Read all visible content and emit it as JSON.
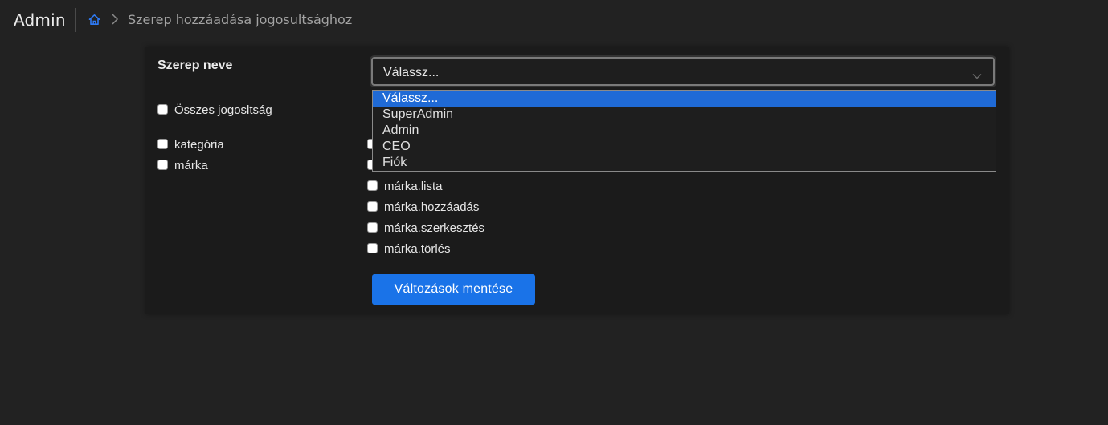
{
  "app": {
    "title": "Admin"
  },
  "breadcrumb": {
    "current": "Szerep hozzáadása jogosultsághoz"
  },
  "form": {
    "role_label": "Szerep neve",
    "role_select": {
      "value": "Válassz...",
      "options": [
        "Válassz...",
        "SuperAdmin",
        "Admin",
        "CEO",
        "Fiók"
      ],
      "selected_index": 0
    },
    "all_permissions_label": "Összes jogosltság",
    "groups": [
      "kategória",
      "márka"
    ],
    "permissions": [
      "márka.lista",
      "márka.hozzáadás",
      "márka.szerkesztés",
      "márka.törlés"
    ],
    "save_label": "Változások mentése"
  },
  "colors": {
    "accent": "#1a73e8",
    "selected_option": "#1f6ad6",
    "home_icon": "#2f7bf5",
    "background": "#222222",
    "card": "#1b1b1b"
  },
  "icons": [
    "home-icon",
    "chevron-right-icon",
    "chevron-down-icon"
  ]
}
